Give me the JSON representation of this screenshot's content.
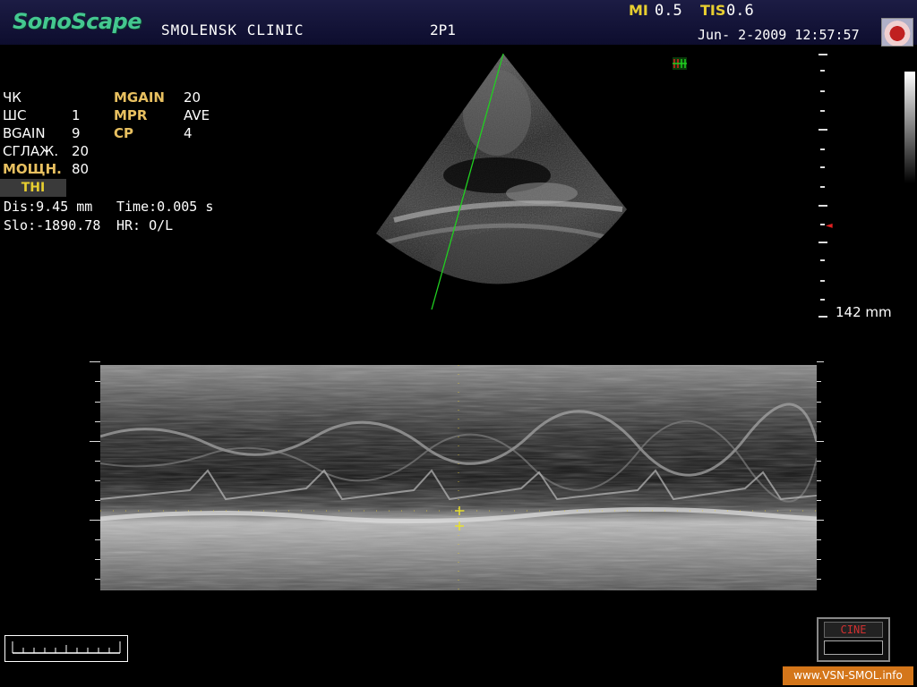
{
  "header": {
    "logo": "SonoScape",
    "clinic": "SMOLENSK CLINIC",
    "probe": "2P1",
    "mi_label": "MI",
    "mi_value": "0.5",
    "tis_label": "TIS",
    "tis_value": "0.6",
    "datetime": "Jun- 2-2009 12:57:57"
  },
  "params": {
    "left": [
      {
        "label": "ЧК",
        "value": ""
      },
      {
        "label": "ШС",
        "value": "1"
      },
      {
        "label": "BGAIN",
        "value": "9"
      },
      {
        "label": "СГЛАЖ.",
        "value": "20"
      },
      {
        "label": "МОЩН.",
        "value": "80"
      }
    ],
    "right": [
      {
        "label": "MGAIN",
        "value": "20"
      },
      {
        "label": "MPR",
        "value": "AVE"
      },
      {
        "label": "CP",
        "value": "4"
      }
    ],
    "thi": "THI"
  },
  "measurements": {
    "dis": "Dis:9.45 mm",
    "slo": "Slo:-1890.78",
    "time": "Time:0.005 s",
    "hr": "HR: O/L"
  },
  "depth": {
    "label": "142 mm"
  },
  "cine": {
    "label": "CINE"
  },
  "watermark": "www.VSN-SMOL.info",
  "colors": {
    "accent_yellow": "#e8cf30",
    "cursor_green": "#20d020",
    "logo_green": "#44c890",
    "watermark_orange": "#d4761a"
  }
}
